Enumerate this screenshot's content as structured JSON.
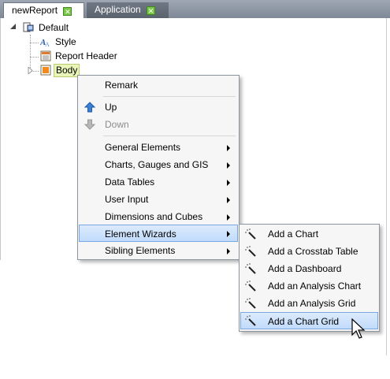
{
  "tabs": [
    {
      "label": "newReport",
      "active": true
    },
    {
      "label": "Application",
      "active": false
    }
  ],
  "tree": {
    "root": "Default",
    "children": [
      "Style",
      "Report Header",
      "Body"
    ]
  },
  "context_menu": {
    "remark": "Remark",
    "up": "Up",
    "down": "Down",
    "items": [
      "General Elements",
      "Charts, Gauges and GIS",
      "Data Tables",
      "User Input",
      "Dimensions and Cubes",
      "Element Wizards",
      "Sibling Elements"
    ],
    "highlighted": "Element Wizards"
  },
  "wizard_menu": {
    "items": [
      "Add a Chart",
      "Add a Crosstab Table",
      "Add a Dashboard",
      "Add an Analysis Chart",
      "Add an Analysis Grid",
      "Add a Chart Grid"
    ],
    "highlighted": "Add a Chart Grid"
  },
  "colors": {
    "highlight": "#c1dbfc",
    "tab_close": "#7cc64a",
    "tab_bar": "#8c95a1"
  }
}
